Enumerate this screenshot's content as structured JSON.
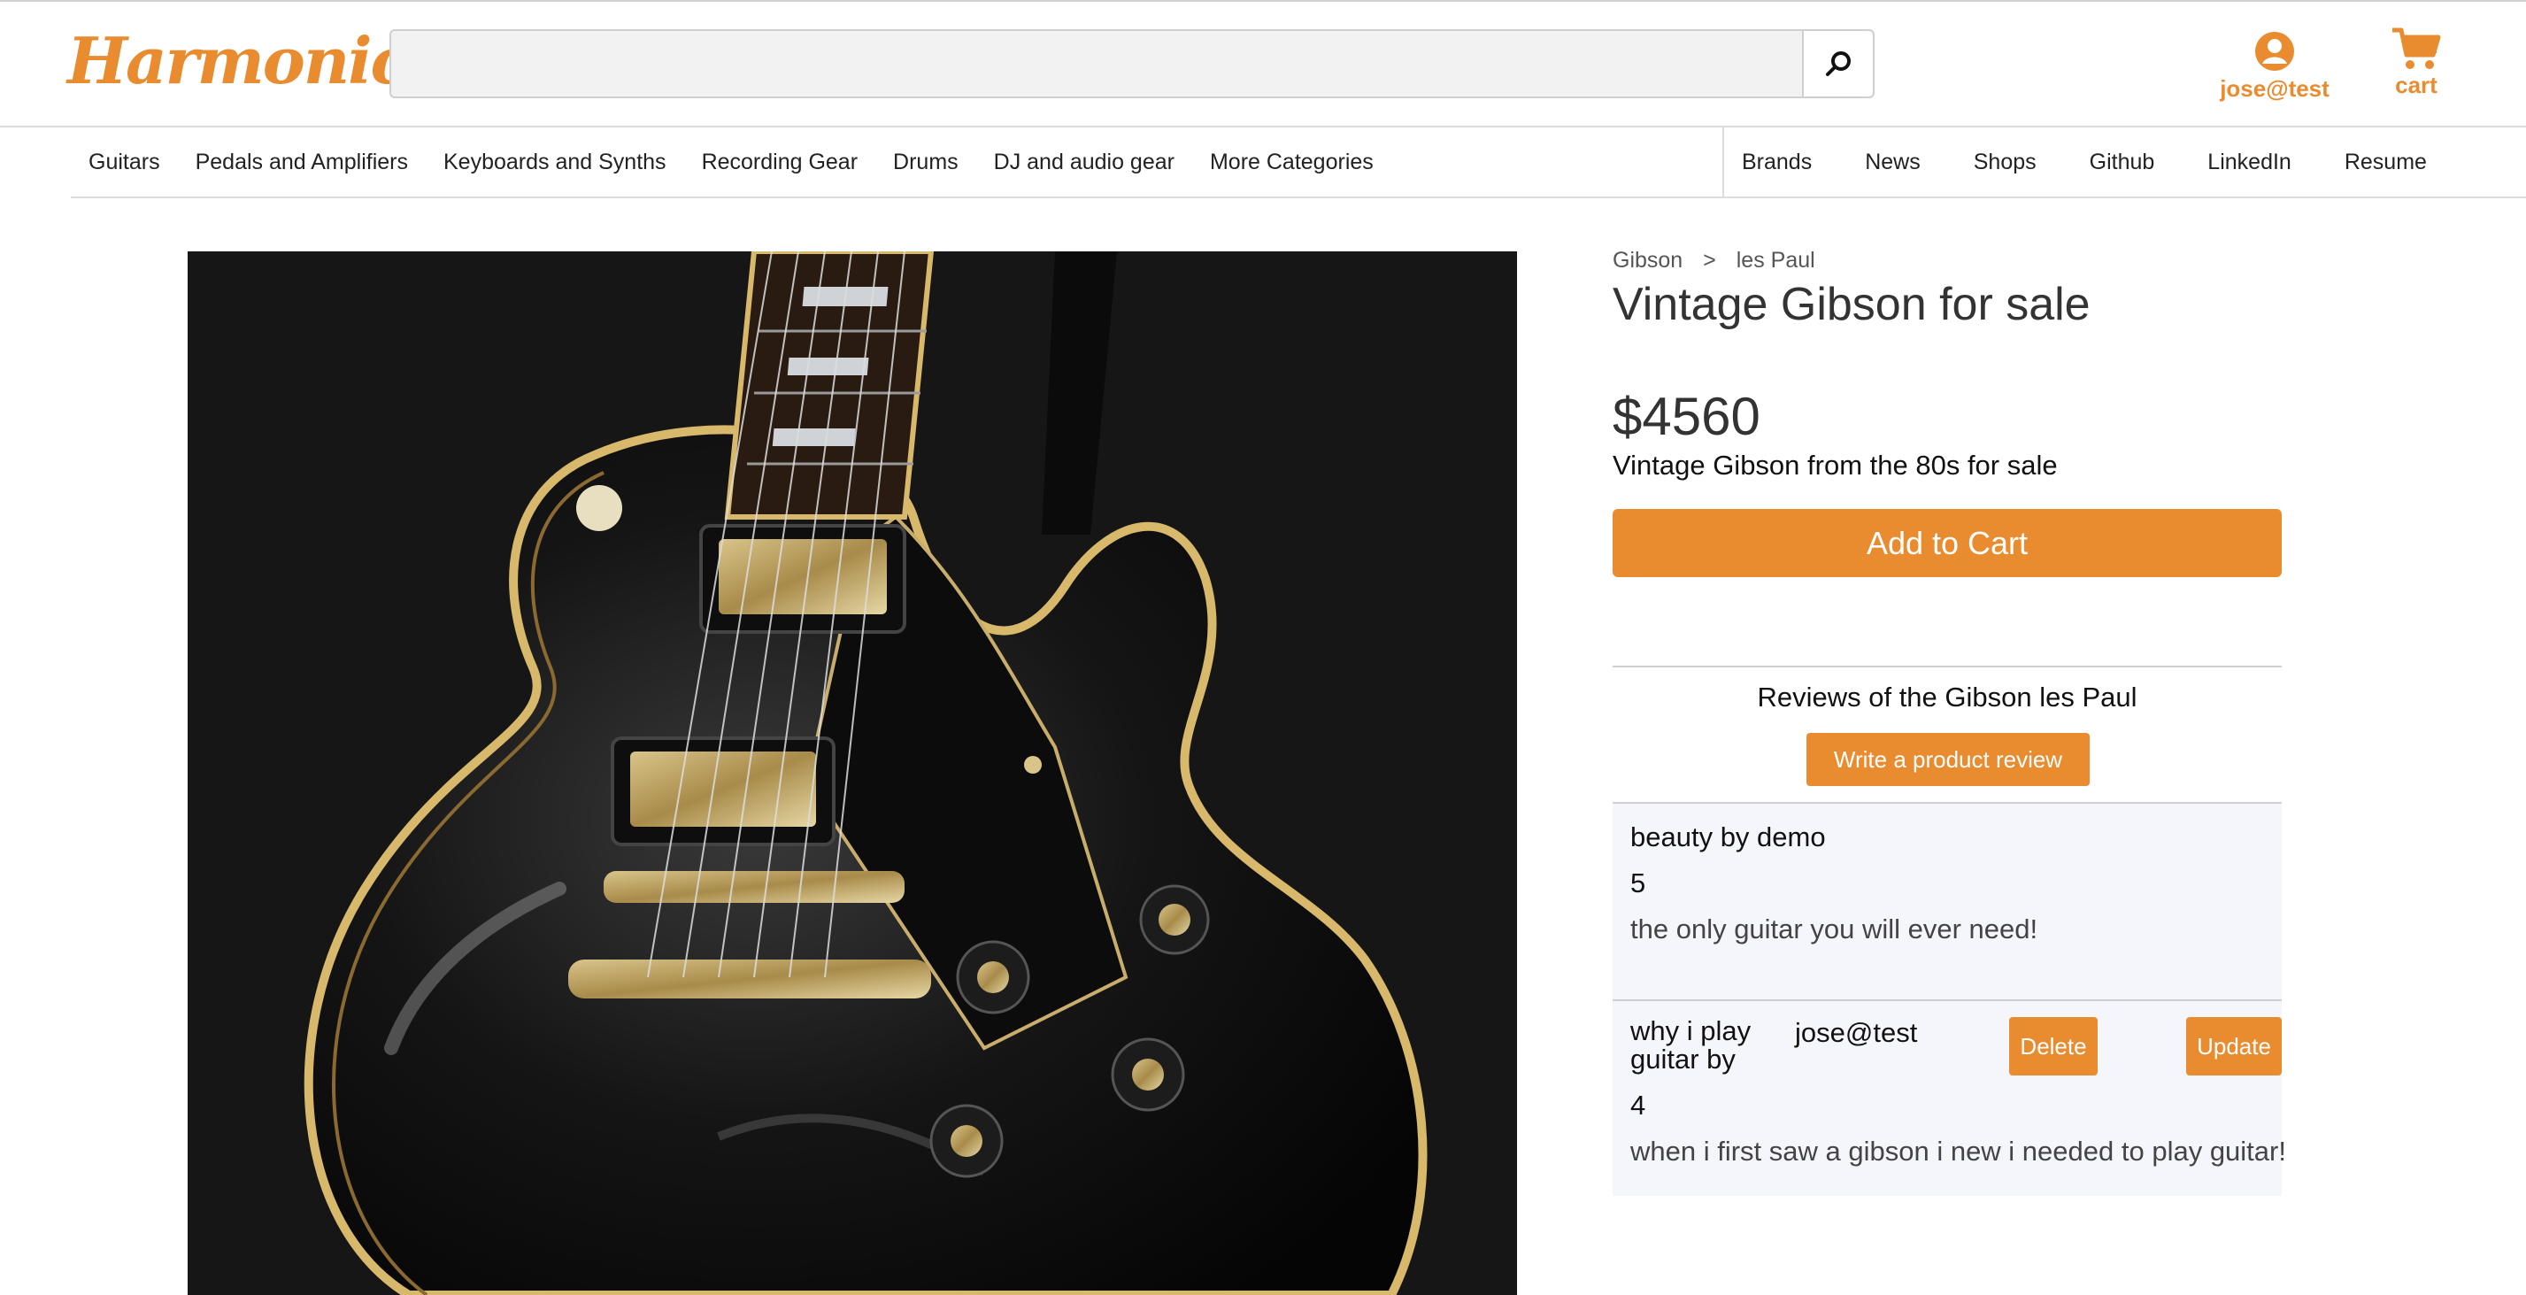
{
  "header": {
    "logo": "Harmonic",
    "search": {
      "value": "",
      "placeholder": ""
    },
    "user_label": "jose@test",
    "cart_label": "cart"
  },
  "nav": {
    "left": [
      "Guitars",
      "Pedals and Amplifiers",
      "Keyboards and Synths",
      "Recording Gear",
      "Drums",
      "DJ and audio gear",
      "More Categories"
    ],
    "right": [
      "Brands",
      "News",
      "Shops",
      "Github",
      "LinkedIn",
      "Resume"
    ]
  },
  "product": {
    "breadcrumb": [
      "Gibson",
      ">",
      "les Paul"
    ],
    "title": "Vintage Gibson for sale",
    "price": "$4560",
    "description": "Vintage Gibson from the 80s for sale",
    "add_to_cart": "Add to Cart"
  },
  "reviews": {
    "heading": "Reviews of the Gibson les Paul",
    "write_label": "Write a product review",
    "items": [
      {
        "title": "beauty by demo",
        "rating": "5",
        "body": "the only guitar you will ever need!"
      },
      {
        "title_line1": "why i play",
        "title_line2": "guitar by",
        "author": "jose@test",
        "rating": "4",
        "body": "when i first saw a gibson i new i needed to play guitar!",
        "delete_label": "Delete",
        "update_label": "Update"
      }
    ]
  },
  "colors": {
    "accent": "#e88c2f",
    "review_bg": "#f5f5fc"
  }
}
